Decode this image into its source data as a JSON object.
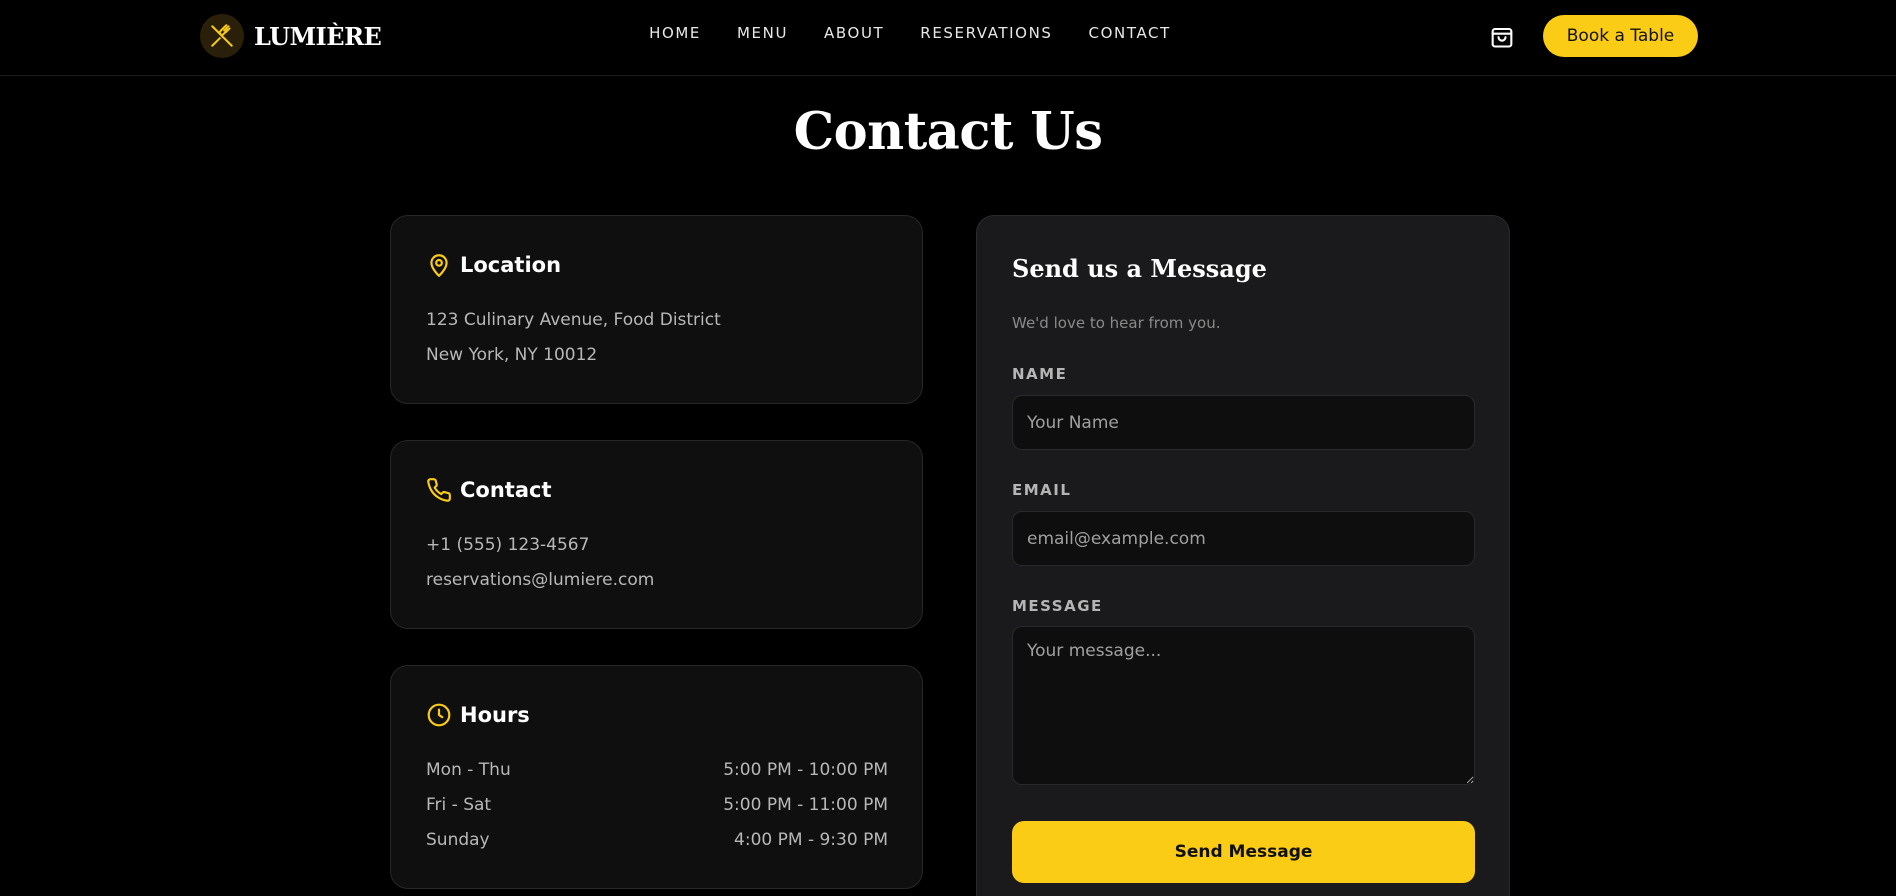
{
  "brand": {
    "name": "LUMIÈRE",
    "logo_icon": "fork-knife-icon",
    "accent": "#facc15"
  },
  "nav": {
    "links": [
      {
        "label": "HOME"
      },
      {
        "label": "MENU"
      },
      {
        "label": "ABOUT"
      },
      {
        "label": "RESERVATIONS"
      },
      {
        "label": "CONTACT"
      }
    ],
    "cart_icon": "shopping-bag-icon",
    "book_label": "Book a Table"
  },
  "page": {
    "title": "Contact Us"
  },
  "location": {
    "icon": "map-pin-icon",
    "title": "Location",
    "lines": [
      "123 Culinary Avenue, Food District",
      "New York, NY 10012"
    ]
  },
  "contact": {
    "icon": "phone-icon",
    "title": "Contact",
    "phone": "+1 (555) 123-4567",
    "email": "reservations@lumiere.com"
  },
  "hours": {
    "icon": "clock-icon",
    "title": "Hours",
    "rows": [
      {
        "day": "Mon - Thu",
        "time": "5:00 PM - 10:00 PM"
      },
      {
        "day": "Fri - Sat",
        "time": "5:00 PM - 11:00 PM"
      },
      {
        "day": "Sunday",
        "time": "4:00 PM - 9:30 PM"
      }
    ]
  },
  "form": {
    "title": "Send us a Message",
    "subtitle": "We'd love to hear from you.",
    "name": {
      "label": "NAME",
      "placeholder": "Your Name",
      "value": ""
    },
    "email": {
      "label": "EMAIL",
      "placeholder": "email@example.com",
      "value": ""
    },
    "message": {
      "label": "MESSAGE",
      "placeholder": "Your message...",
      "value": ""
    },
    "submit_label": "Send Message"
  }
}
